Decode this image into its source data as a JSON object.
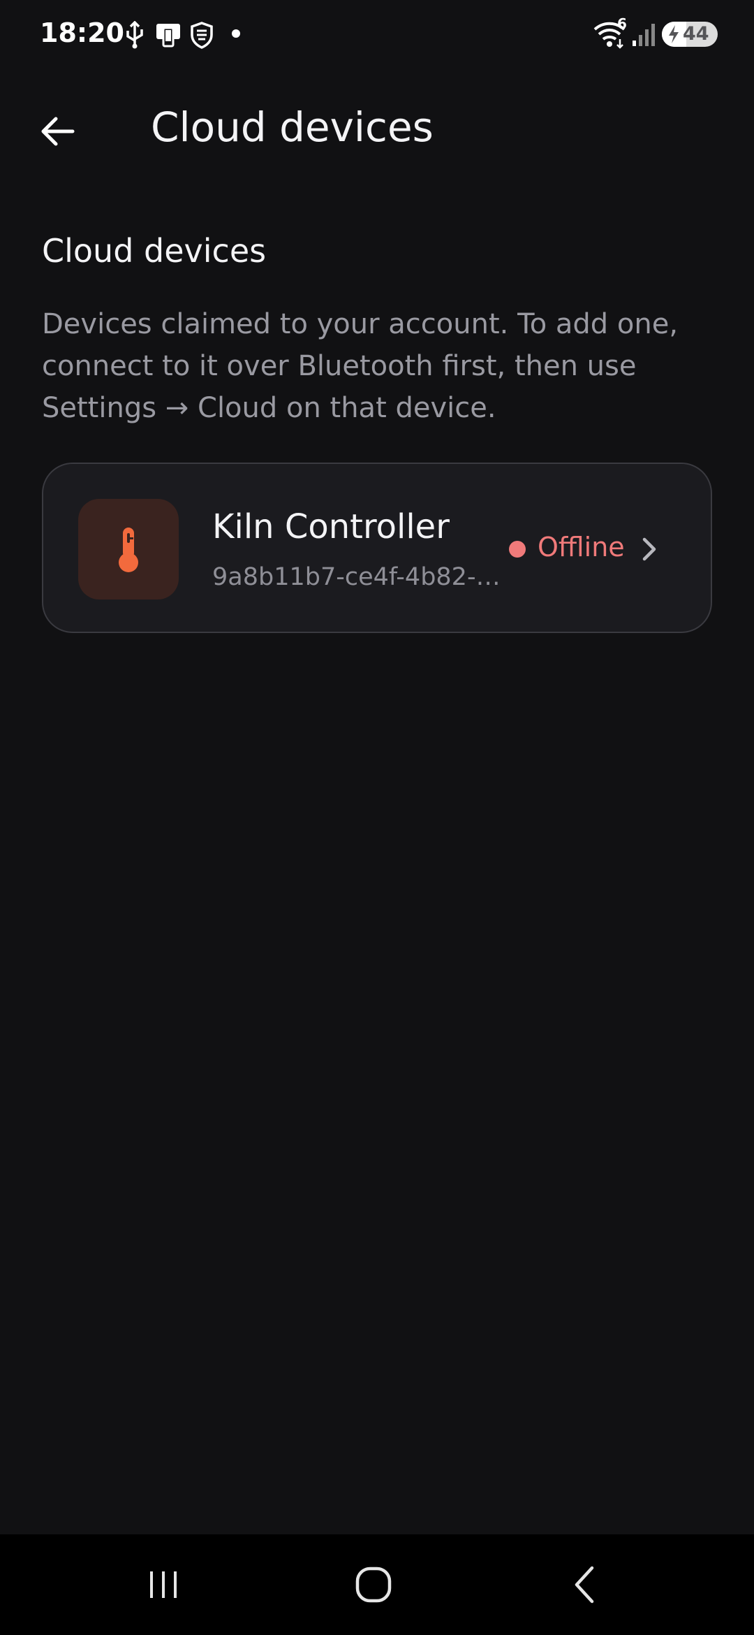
{
  "status_bar": {
    "time": "18:20",
    "left_icons": [
      "usb-icon",
      "phone-link-icon",
      "shield-icon",
      "notification-dot-icon"
    ],
    "right_icons": [
      "wifi-icon",
      "cell-signal-icon"
    ],
    "wifi_badge": "6",
    "battery_level": "44",
    "battery_fraction": 0.44,
    "charging": true
  },
  "header": {
    "title": "Cloud devices",
    "back_icon": "arrow-left-icon"
  },
  "section": {
    "heading": "Cloud devices",
    "description": "Devices claimed to your account. To add one, connect to it over Bluetooth first, then use Settings → Cloud on that device."
  },
  "devices": [
    {
      "name": "Kiln Controller",
      "id": "9a8b11b7-ce4f-4b82-a…",
      "status": "Offline",
      "icon": "thermometer-icon"
    }
  ],
  "colors": {
    "background": "#111113",
    "card": "#1b1b1f",
    "card_border": "#3a3a40",
    "accent_orange": "#f26a3d",
    "icon_bg": "#3a231f",
    "offline_red": "#f07a7a",
    "muted_text": "#9a9aa2"
  },
  "nav_bar": {
    "buttons": [
      "recent-apps-icon",
      "home-icon",
      "back-icon"
    ]
  }
}
